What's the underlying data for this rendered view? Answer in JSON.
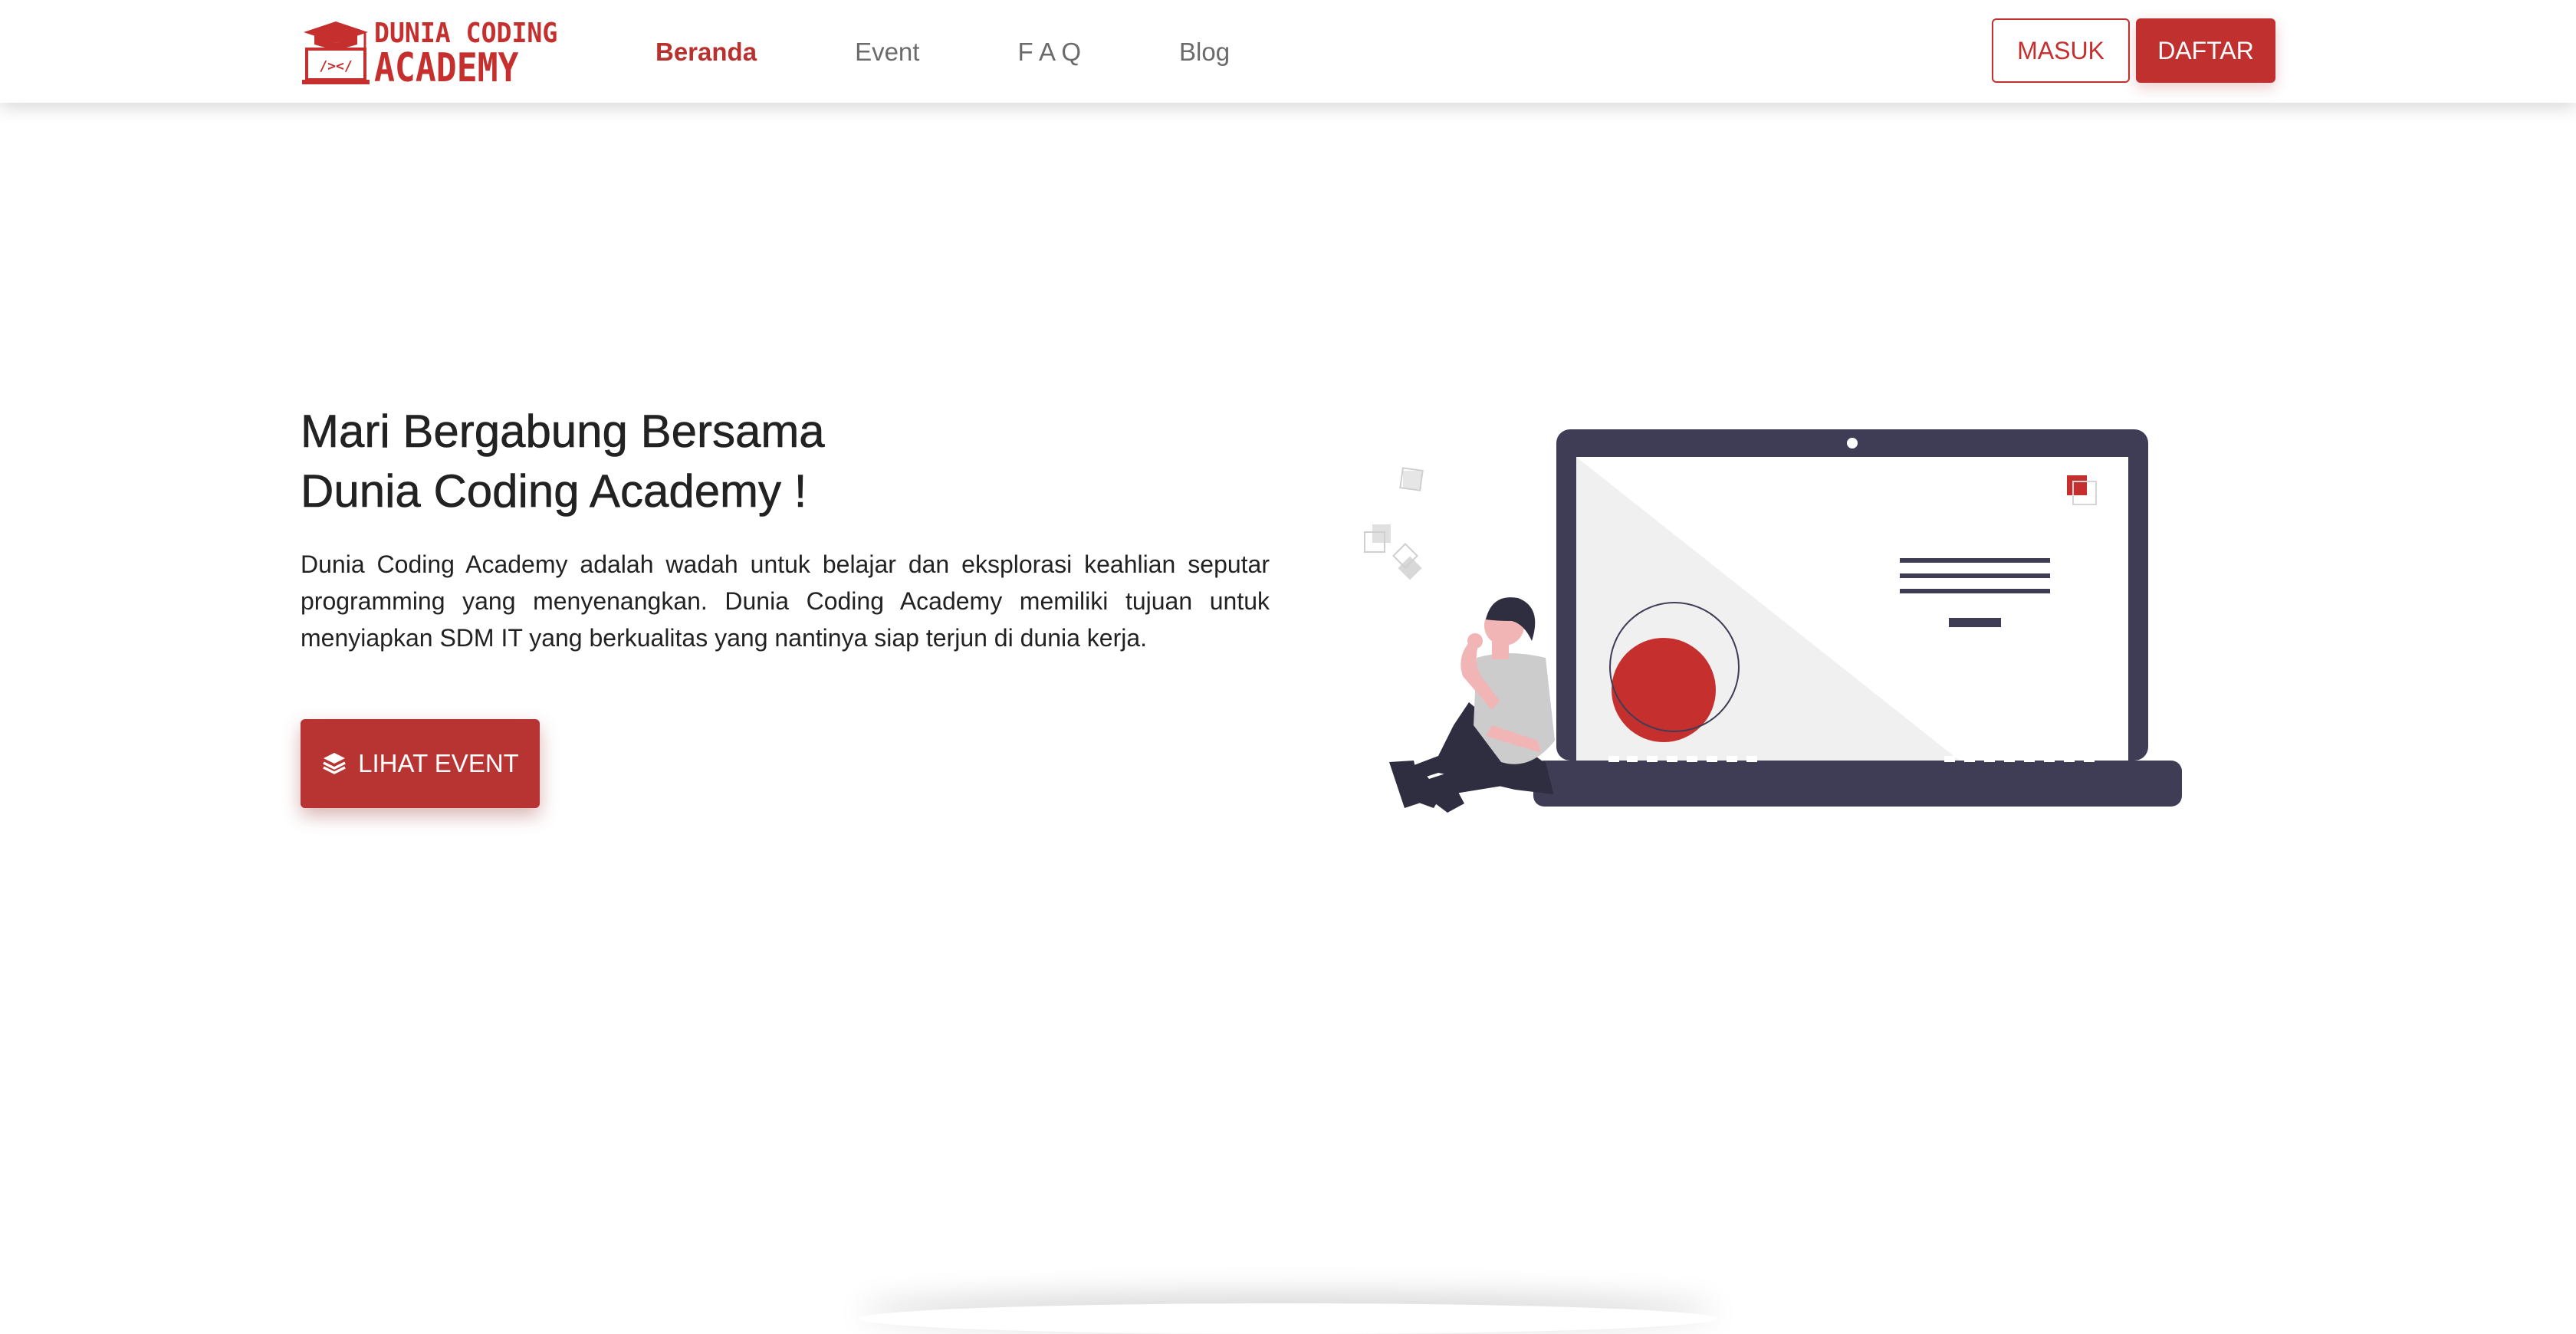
{
  "brand": {
    "line1": "DUNIA CODING",
    "line2": "ACADEMY",
    "icon": "graduation-cap-laptop-logo",
    "color": "#c5302e"
  },
  "nav": {
    "items": [
      {
        "label": "Beranda",
        "active": true
      },
      {
        "label": "Event",
        "active": false
      },
      {
        "label": "F A Q",
        "active": false
      },
      {
        "label": "Blog",
        "active": false
      }
    ]
  },
  "auth": {
    "login_label": "MASUK",
    "register_label": "DAFTAR"
  },
  "hero": {
    "title_line1": "Mari Bergabung Bersama",
    "title_line2": "Dunia Coding Academy !",
    "description": "Dunia Coding Academy adalah wadah untuk belajar dan eksplorasi keahlian seputar programming yang menyenangkan. Dunia Coding Academy memiliki tujuan untuk menyiapkan SDM IT yang berkualitas yang nantinya siap terjun di dunia kerja.",
    "cta_label": "LIHAT EVENT",
    "cta_icon": "layers-icon",
    "illustration": "person-with-laptop-illustration"
  },
  "colors": {
    "accent": "#c0302e",
    "laptop": "#3f3d56",
    "text": "#222222",
    "nav_inactive": "#6b6b6b"
  }
}
